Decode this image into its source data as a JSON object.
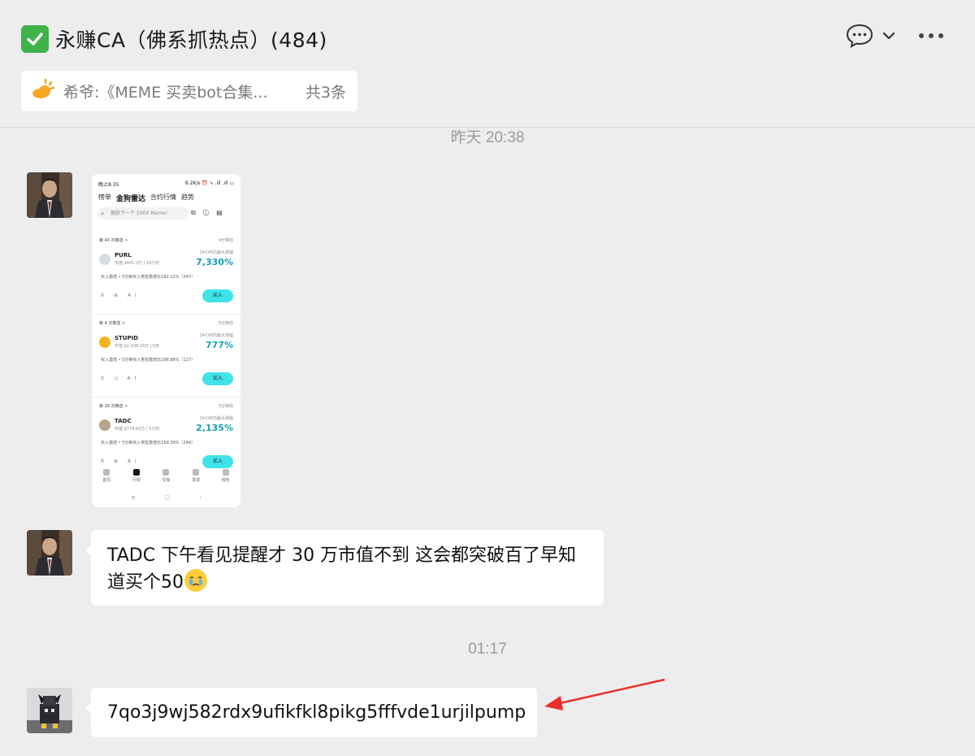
{
  "header": {
    "title": "永赚CA（佛系抓热点）(484)",
    "icons": [
      "check-box-icon",
      "chat-bubble-icon",
      "chevron-down-icon",
      "more-icon"
    ]
  },
  "pinned": {
    "text": "希爷:《MEME 买卖bot合集...",
    "count": "共3条",
    "icon": "pin-sun-icon"
  },
  "timestamps": {
    "first": "昨天 20:38",
    "second": "01:17"
  },
  "messages": [
    {
      "type": "image"
    },
    {
      "type": "text",
      "text_line1": "TADC 下午看见提醒才 30 万市值不到 这会都突破百了早知",
      "text_line2": "道买个50"
    },
    {
      "type": "text",
      "text": "7qo3j9wj582rdx9ufikfkl8pikg5fffvde1urjilpump"
    }
  ],
  "screenshot": {
    "status_time": "晚上8:35",
    "status_right": "8.2K/s ⏰ ∿ .ıll .ıll ▭",
    "tabs": [
      "榜单",
      "金狗雷达",
      "合约行情",
      "趋势"
    ],
    "search_placeholder": "捕获下一个 100X Meme!",
    "cards": [
      {
        "alert": "第 40 次推送 >",
        "ago": "4分钟前",
        "name": "PURL",
        "meta": "市值 $441.3万 | 10小时",
        "gain_label": "24小时内最大涨幅",
        "gain": "7,330%",
        "signal": "买入激增 • 5分钟买入地址数增长182.11%（347）",
        "socials": "X ⊕ AI",
        "buy": "买入",
        "icon_color": "#d9dde0"
      },
      {
        "alert": "第 4 次推送 >",
        "ago": "5分钟前",
        "name": "STUPID",
        "meta": "市值 $2,108.15万 | 6天",
        "gain_label": "24小时内最大涨幅",
        "gain": "777%",
        "signal": "买入激增 • 5分钟买入地址数增长298.88%（127）",
        "socials": "X ◁ AI",
        "buy": "买入",
        "icon_color": "#f2b41d"
      },
      {
        "alert": "第 18 次推送 >",
        "ago": "5分钟前",
        "name": "TADC",
        "meta": "市值 $779.62万 | 5小时",
        "gain_label": "24小时内最大涨幅",
        "gain": "2,135%",
        "signal": "买入激增 • 5分钟买入地址数增长169.39%（264）",
        "socials": "X ⊕ AI",
        "buy": "买入",
        "icon_color": "#b7a48a"
      }
    ],
    "nav": [
      "首页",
      "行情",
      "交易",
      "发现",
      "钱包"
    ],
    "sys": [
      "≡",
      "▢",
      "‹"
    ]
  },
  "colors": {
    "background": "#ededed",
    "bubble": "#ffffff",
    "accent_green": "#3fb24a",
    "arrow_red": "#e8302a",
    "gain_teal": "#17a0b3"
  }
}
